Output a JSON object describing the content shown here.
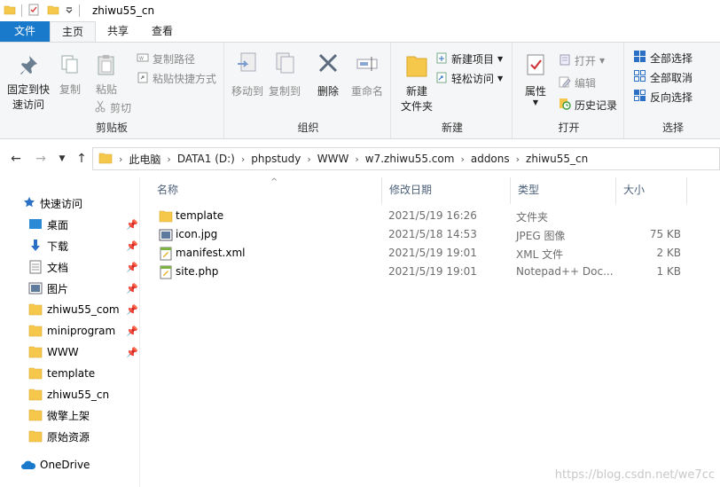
{
  "window": {
    "title": "zhiwu55_cn"
  },
  "tabs": [
    {
      "label": "文件"
    },
    {
      "label": "主页"
    },
    {
      "label": "共享"
    },
    {
      "label": "查看"
    }
  ],
  "ribbon": {
    "clipboard": {
      "label": "剪贴板",
      "pin_quick_access": "固定到快\n速访问",
      "copy": "复制",
      "paste": "粘贴",
      "copy_path": "复制路径",
      "paste_shortcut": "粘贴快捷方式",
      "cut": "剪切"
    },
    "organize": {
      "label": "组织",
      "move_to": "移动到",
      "copy_to": "复制到",
      "delete": "删除",
      "rename": "重命名"
    },
    "new": {
      "label": "新建",
      "new_folder": "新建\n文件夹",
      "new_item": "新建项目",
      "easy_access": "轻松访问"
    },
    "open": {
      "label": "打开",
      "properties": "属性",
      "open": "打开",
      "edit": "编辑",
      "history": "历史记录"
    },
    "select": {
      "label": "选择",
      "select_all": "全部选择",
      "select_none": "全部取消",
      "invert": "反向选择"
    }
  },
  "address": {
    "crumbs": [
      "此电脑",
      "DATA1 (D:)",
      "phpstudy",
      "WWW",
      "w7.zhiwu55.com",
      "addons",
      "zhiwu55_cn"
    ]
  },
  "navpane": {
    "quick_access": "快速访问",
    "items": [
      {
        "label": "桌面",
        "icon": "desktop-icon",
        "pinned": true
      },
      {
        "label": "下载",
        "icon": "download-icon",
        "pinned": true
      },
      {
        "label": "文档",
        "icon": "document-icon",
        "pinned": true
      },
      {
        "label": "图片",
        "icon": "picture-icon",
        "pinned": true
      },
      {
        "label": "zhiwu55_com",
        "icon": "folder-icon",
        "pinned": true
      },
      {
        "label": "miniprogram",
        "icon": "folder-icon",
        "pinned": true
      },
      {
        "label": "WWW",
        "icon": "folder-icon",
        "pinned": true
      },
      {
        "label": "template",
        "icon": "folder-icon",
        "pinned": false
      },
      {
        "label": "zhiwu55_cn",
        "icon": "folder-icon",
        "pinned": false
      },
      {
        "label": "微擎上架",
        "icon": "folder-icon",
        "pinned": false
      },
      {
        "label": "原始资源",
        "icon": "folder-icon",
        "pinned": false
      }
    ],
    "onedrive": "OneDrive"
  },
  "filelist": {
    "columns": {
      "name": "名称",
      "date": "修改日期",
      "type": "类型",
      "size": "大小"
    },
    "files": [
      {
        "name": "template",
        "date": "2021/5/19 16:26",
        "type": "文件夹",
        "size": "",
        "icon": "folder-icon"
      },
      {
        "name": "icon.jpg",
        "date": "2021/5/18 14:53",
        "type": "JPEG 图像",
        "size": "75 KB",
        "icon": "image-file-icon"
      },
      {
        "name": "manifest.xml",
        "date": "2021/5/19 19:01",
        "type": "XML 文件",
        "size": "2 KB",
        "icon": "xml-file-icon"
      },
      {
        "name": "site.php",
        "date": "2021/5/19 19:01",
        "type": "Notepad++ Doc...",
        "size": "1 KB",
        "icon": "php-file-icon"
      }
    ]
  },
  "watermark": "https://blog.csdn.net/we7cc",
  "colors": {
    "accent": "#1979ca",
    "folder": "#f5c84c",
    "header_text": "#4c607a"
  }
}
